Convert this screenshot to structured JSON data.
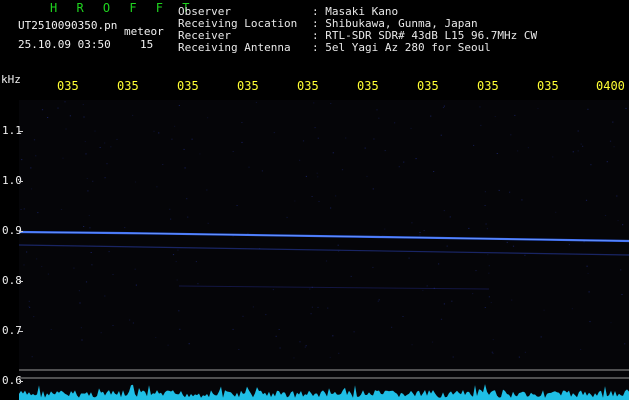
{
  "header": {
    "title": "H R O F F T",
    "filename": "UT2510090350.pn",
    "detect_label": "meteor",
    "timestamp": "25.10.09 03:50",
    "count": "15"
  },
  "info": {
    "observer_label": "Observer",
    "observer_value": ": Masaki Kano",
    "location_label": "Receiving Location",
    "location_value": ": Shibukawa, Gunma, Japan",
    "receiver_label": "Receiver",
    "receiver_value": ": RTL-SDR SDR# 43dB L15 96.7MHz CW",
    "antenna_label": "Receiving Antenna",
    "antenna_value": ": 5el Yagi Az 280 for Seoul"
  },
  "axis": {
    "unit": "kHz",
    "y_ticks": [
      "1.1",
      "1.0",
      "0.9",
      "0.8",
      "0.7",
      "0.6"
    ],
    "x_ticks": [
      "035",
      "035",
      "035",
      "035",
      "035",
      "035",
      "035",
      "035",
      "035",
      "0400"
    ]
  },
  "colors": {
    "background": "#000000",
    "title": "#1fd41f",
    "ticks_x": "#ffff33",
    "signal": "#3b6fff",
    "noise": "#22d4ff"
  }
}
